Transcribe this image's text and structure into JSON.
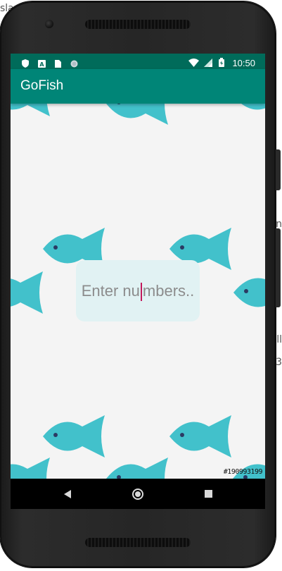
{
  "background": {
    "left_text_top": "sla",
    "right_text_1": "n",
    "right_text_2": "ll",
    "right_text_3": "3"
  },
  "status_bar": {
    "time": "10:50",
    "left_icons": [
      "shield-icon",
      "a-box-icon",
      "sim-card-icon",
      "circle-dot-icon"
    ],
    "right_icons": [
      "wifi-icon",
      "cell-signal-icon",
      "battery-icon"
    ],
    "color": "#006b5a"
  },
  "app_bar": {
    "title": "GoFish",
    "color": "#008577"
  },
  "main": {
    "input": {
      "placeholder": "Enter numbers..",
      "text_before_cursor": "Enter nu",
      "text_after_cursor": "mbers..",
      "box_color": "#e1f2f3",
      "cursor_color": "#c2185b"
    },
    "fish_color": "#42c1cb",
    "fish_eye_color": "#2b3a63",
    "background_color": "#f4f4f4",
    "build_tag": "#190993199"
  },
  "nav_bar": {
    "buttons": [
      "back-triangle-icon",
      "home-circle-icon",
      "recents-square-icon"
    ]
  }
}
